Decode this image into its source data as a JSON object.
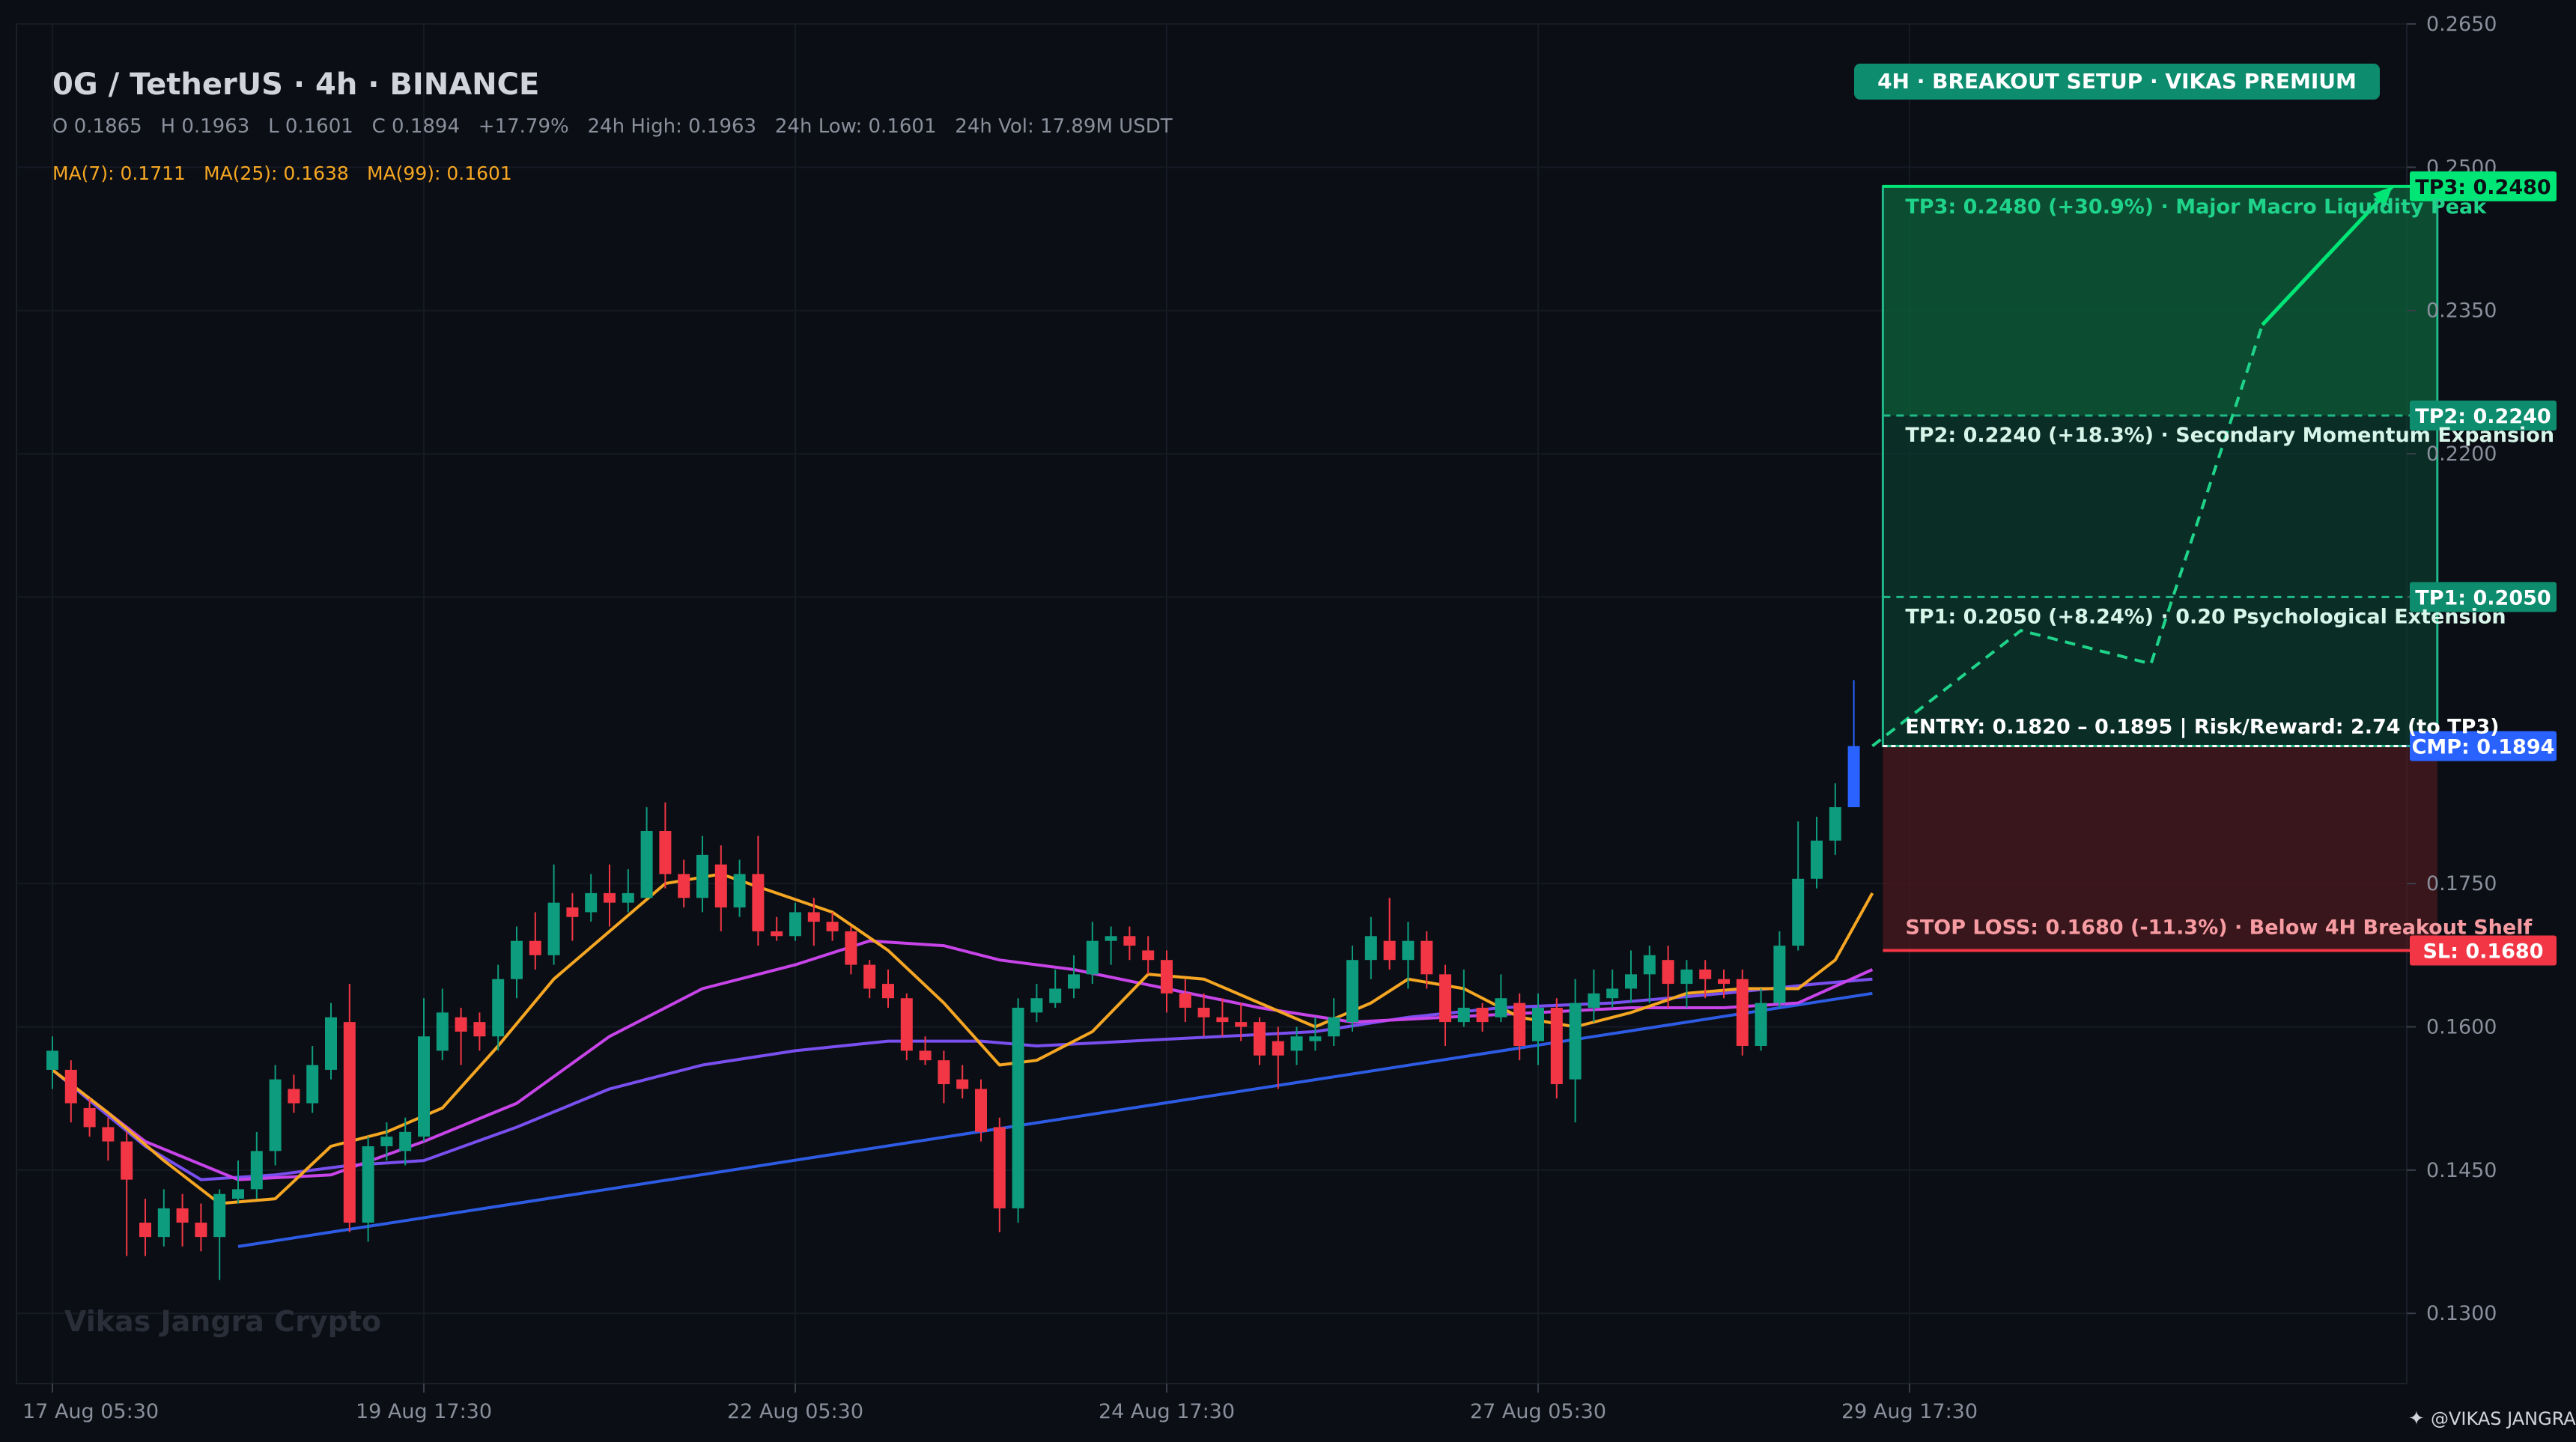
{
  "header": {
    "title": "0G / TetherUS · 4h · BINANCE",
    "ohlc_text": "O 0.1865   H 0.1963   L 0.1601   C 0.1894   +17.79%   24h High: 0.1963   24h Low: 0.1601   24h Vol: 17.89M USDT",
    "ma_labels": [
      "MA(7): 0.1711",
      "MA(25): 0.1638",
      "MA(99): 0.1601"
    ]
  },
  "badge": {
    "text": "4H · BREAKOUT SETUP · VIKAS PREMIUM"
  },
  "watermark": "Vikas Jangra Crypto",
  "credit": "@VIKAS JANGRA",
  "colors": {
    "background": "#0b0e14",
    "up": "#0e9c7e",
    "down": "#f23645",
    "ma7": "#f5a623",
    "ma25": "#c744e8",
    "ma99": "#7a4ff0",
    "trendline": "#2d5be3",
    "target_zone": "#0d5e3a",
    "stop_zone": "#4a1a1e",
    "tp3": "#00e676",
    "tp_badge": "#0e8c6e",
    "cmp": "#2962ff",
    "sl": "#f23645"
  },
  "chart_data": {
    "type": "candlestick",
    "ylim": [
      0.125,
      0.265
    ],
    "y_ticks": [
      "0.1300",
      "0.1450",
      "0.1600",
      "0.1750",
      "0.2050",
      "0.2200",
      "0.2350",
      "0.2500",
      "0.2650"
    ],
    "x_labels": [
      "17 Aug 05:30",
      "19 Aug 17:30",
      "22 Aug 05:30",
      "24 Aug 17:30",
      "27 Aug 05:30",
      "29 Aug 17:30"
    ],
    "x_label_index": [
      0,
      20,
      40,
      60,
      80,
      100
    ],
    "candles": [
      [
        0.1555,
        0.1575,
        0.159,
        0.1535
      ],
      [
        0.1555,
        0.152,
        0.1565,
        0.15
      ],
      [
        0.1515,
        0.1495,
        0.1525,
        0.1485
      ],
      [
        0.1495,
        0.148,
        0.1505,
        0.146
      ],
      [
        0.148,
        0.144,
        0.149,
        0.136
      ],
      [
        0.1395,
        0.138,
        0.142,
        0.136
      ],
      [
        0.138,
        0.141,
        0.143,
        0.137
      ],
      [
        0.141,
        0.1395,
        0.1425,
        0.137
      ],
      [
        0.1395,
        0.138,
        0.1415,
        0.1365
      ],
      [
        0.138,
        0.1425,
        0.143,
        0.1335
      ],
      [
        0.142,
        0.143,
        0.146,
        0.1415
      ],
      [
        0.143,
        0.147,
        0.149,
        0.142
      ],
      [
        0.147,
        0.1545,
        0.156,
        0.1455
      ],
      [
        0.1535,
        0.152,
        0.155,
        0.151
      ],
      [
        0.152,
        0.156,
        0.158,
        0.151
      ],
      [
        0.1555,
        0.161,
        0.1625,
        0.1545
      ],
      [
        0.1605,
        0.1395,
        0.1645,
        0.1385
      ],
      [
        0.1395,
        0.1475,
        0.1485,
        0.1375
      ],
      [
        0.1475,
        0.1485,
        0.15,
        0.146
      ],
      [
        0.147,
        0.149,
        0.1505,
        0.1455
      ],
      [
        0.1485,
        0.159,
        0.163,
        0.148
      ],
      [
        0.1575,
        0.1615,
        0.164,
        0.1565
      ],
      [
        0.161,
        0.1595,
        0.162,
        0.156
      ],
      [
        0.1605,
        0.159,
        0.1615,
        0.1575
      ],
      [
        0.159,
        0.165,
        0.1665,
        0.1575
      ],
      [
        0.165,
        0.169,
        0.1705,
        0.163
      ],
      [
        0.169,
        0.1675,
        0.172,
        0.166
      ],
      [
        0.1675,
        0.173,
        0.177,
        0.1665
      ],
      [
        0.1725,
        0.1715,
        0.174,
        0.169
      ],
      [
        0.172,
        0.174,
        0.176,
        0.171
      ],
      [
        0.174,
        0.173,
        0.177,
        0.1705
      ],
      [
        0.173,
        0.174,
        0.1765,
        0.172
      ],
      [
        0.1735,
        0.1805,
        0.183,
        0.1735
      ],
      [
        0.1805,
        0.176,
        0.1835,
        0.1745
      ],
      [
        0.176,
        0.1735,
        0.1775,
        0.1725
      ],
      [
        0.1735,
        0.178,
        0.18,
        0.172
      ],
      [
        0.177,
        0.1725,
        0.179,
        0.17
      ],
      [
        0.1725,
        0.176,
        0.1775,
        0.1715
      ],
      [
        0.176,
        0.17,
        0.18,
        0.1685
      ],
      [
        0.17,
        0.1695,
        0.1715,
        0.169
      ],
      [
        0.1695,
        0.172,
        0.173,
        0.169
      ],
      [
        0.172,
        0.171,
        0.1735,
        0.1685
      ],
      [
        0.171,
        0.17,
        0.172,
        0.169
      ],
      [
        0.17,
        0.1665,
        0.1705,
        0.1655
      ],
      [
        0.1665,
        0.164,
        0.167,
        0.163
      ],
      [
        0.1645,
        0.163,
        0.166,
        0.162
      ],
      [
        0.163,
        0.1575,
        0.1635,
        0.1565
      ],
      [
        0.1575,
        0.1565,
        0.159,
        0.156
      ],
      [
        0.1565,
        0.154,
        0.1575,
        0.152
      ],
      [
        0.1545,
        0.1535,
        0.156,
        0.1525
      ],
      [
        0.1535,
        0.149,
        0.1545,
        0.148
      ],
      [
        0.1495,
        0.141,
        0.1505,
        0.1385
      ],
      [
        0.141,
        0.162,
        0.163,
        0.1395
      ],
      [
        0.1615,
        0.163,
        0.1645,
        0.1605
      ],
      [
        0.1625,
        0.164,
        0.166,
        0.162
      ],
      [
        0.164,
        0.1655,
        0.1675,
        0.163
      ],
      [
        0.1655,
        0.169,
        0.171,
        0.1645
      ],
      [
        0.169,
        0.1695,
        0.1705,
        0.1665
      ],
      [
        0.1695,
        0.1685,
        0.1705,
        0.167
      ],
      [
        0.168,
        0.167,
        0.1695,
        0.1655
      ],
      [
        0.167,
        0.1635,
        0.168,
        0.1615
      ],
      [
        0.1635,
        0.162,
        0.165,
        0.1605
      ],
      [
        0.162,
        0.161,
        0.1635,
        0.159
      ],
      [
        0.161,
        0.1605,
        0.163,
        0.159
      ],
      [
        0.1605,
        0.16,
        0.1625,
        0.1585
      ],
      [
        0.1605,
        0.157,
        0.161,
        0.156
      ],
      [
        0.1585,
        0.157,
        0.16,
        0.1535
      ],
      [
        0.1575,
        0.159,
        0.16,
        0.156
      ],
      [
        0.1585,
        0.159,
        0.161,
        0.1575
      ],
      [
        0.159,
        0.161,
        0.163,
        0.158
      ],
      [
        0.1605,
        0.167,
        0.1685,
        0.1595
      ],
      [
        0.167,
        0.1695,
        0.1715,
        0.165
      ],
      [
        0.169,
        0.167,
        0.1735,
        0.166
      ],
      [
        0.167,
        0.169,
        0.171,
        0.164
      ],
      [
        0.169,
        0.1655,
        0.17,
        0.164
      ],
      [
        0.1655,
        0.1605,
        0.1665,
        0.158
      ],
      [
        0.1605,
        0.162,
        0.166,
        0.16
      ],
      [
        0.162,
        0.1605,
        0.1625,
        0.1595
      ],
      [
        0.161,
        0.163,
        0.1655,
        0.1605
      ],
      [
        0.1625,
        0.158,
        0.1635,
        0.1565
      ],
      [
        0.1585,
        0.162,
        0.1635,
        0.156
      ],
      [
        0.162,
        0.154,
        0.163,
        0.1525
      ],
      [
        0.1545,
        0.1625,
        0.165,
        0.15
      ],
      [
        0.162,
        0.1635,
        0.166,
        0.1605
      ],
      [
        0.163,
        0.164,
        0.166,
        0.162
      ],
      [
        0.164,
        0.1655,
        0.168,
        0.1625
      ],
      [
        0.1655,
        0.1675,
        0.1685,
        0.1625
      ],
      [
        0.167,
        0.1645,
        0.1685,
        0.162
      ],
      [
        0.1645,
        0.166,
        0.167,
        0.162
      ],
      [
        0.166,
        0.165,
        0.167,
        0.163
      ],
      [
        0.165,
        0.1645,
        0.166,
        0.163
      ],
      [
        0.165,
        0.158,
        0.166,
        0.157
      ],
      [
        0.158,
        0.1625,
        0.164,
        0.1575
      ],
      [
        0.1625,
        0.1685,
        0.17,
        0.162
      ],
      [
        0.1685,
        0.1755,
        0.1815,
        0.168
      ],
      [
        0.1755,
        0.1795,
        0.182,
        0.1745
      ],
      [
        0.1795,
        0.183,
        0.1855,
        0.178
      ],
      [
        0.183,
        0.1894,
        0.1963,
        0.183
      ]
    ],
    "indicators": {
      "ma7": [
        [
          0,
          0.1555
        ],
        [
          3,
          0.151
        ],
        [
          6,
          0.146
        ],
        [
          9,
          0.1415
        ],
        [
          12,
          0.142
        ],
        [
          15,
          0.1475
        ],
        [
          18,
          0.149
        ],
        [
          21,
          0.1515
        ],
        [
          24,
          0.158
        ],
        [
          27,
          0.165
        ],
        [
          30,
          0.17
        ],
        [
          33,
          0.175
        ],
        [
          36,
          0.176
        ],
        [
          39,
          0.174
        ],
        [
          42,
          0.172
        ],
        [
          45,
          0.168
        ],
        [
          48,
          0.1625
        ],
        [
          51,
          0.156
        ],
        [
          53,
          0.1565
        ],
        [
          56,
          0.1595
        ],
        [
          59,
          0.1655
        ],
        [
          62,
          0.165
        ],
        [
          65,
          0.1625
        ],
        [
          68,
          0.16
        ],
        [
          71,
          0.1625
        ],
        [
          73,
          0.165
        ],
        [
          76,
          0.164
        ],
        [
          79,
          0.161
        ],
        [
          82,
          0.16
        ],
        [
          85,
          0.1615
        ],
        [
          88,
          0.1635
        ],
        [
          91,
          0.164
        ],
        [
          94,
          0.164
        ],
        [
          96,
          0.167
        ],
        [
          98,
          0.174
        ]
      ],
      "ma25": [
        [
          0,
          0.1555
        ],
        [
          5,
          0.148
        ],
        [
          10,
          0.144
        ],
        [
          15,
          0.1445
        ],
        [
          20,
          0.148
        ],
        [
          25,
          0.152
        ],
        [
          30,
          0.159
        ],
        [
          35,
          0.164
        ],
        [
          40,
          0.1665
        ],
        [
          44,
          0.169
        ],
        [
          48,
          0.1685
        ],
        [
          51,
          0.167
        ],
        [
          55,
          0.166
        ],
        [
          60,
          0.164
        ],
        [
          65,
          0.162
        ],
        [
          70,
          0.1605
        ],
        [
          75,
          0.161
        ],
        [
          80,
          0.1615
        ],
        [
          85,
          0.162
        ],
        [
          90,
          0.162
        ],
        [
          94,
          0.1625
        ],
        [
          98,
          0.166
        ]
      ],
      "ma99": [
        [
          0,
          0.1555
        ],
        [
          5,
          0.1475
        ],
        [
          8,
          0.144
        ],
        [
          12,
          0.1445
        ],
        [
          16,
          0.1455
        ],
        [
          20,
          0.146
        ],
        [
          25,
          0.1495
        ],
        [
          30,
          0.1535
        ],
        [
          35,
          0.156
        ],
        [
          40,
          0.1575
        ],
        [
          45,
          0.1585
        ],
        [
          50,
          0.1585
        ],
        [
          53,
          0.158
        ],
        [
          58,
          0.1585
        ],
        [
          63,
          0.159
        ],
        [
          68,
          0.1595
        ],
        [
          73,
          0.161
        ],
        [
          78,
          0.162
        ],
        [
          84,
          0.1625
        ],
        [
          90,
          0.1635
        ],
        [
          95,
          0.1645
        ],
        [
          98,
          0.165
        ]
      ],
      "trendline": [
        [
          10,
          0.137
        ],
        [
          98,
          0.1635
        ]
      ]
    },
    "levels": {
      "entry": [
        0.182,
        0.1895
      ],
      "cmp": 0.1894,
      "tp1": 0.205,
      "tp2": 0.224,
      "tp3": 0.248,
      "sl": 0.168,
      "risk_reward_to_tp3": 2.74
    },
    "projection_path": [
      [
        98,
        0.1894
      ],
      [
        106,
        0.2015
      ],
      [
        113,
        0.198
      ],
      [
        119,
        0.2335
      ],
      [
        126,
        0.248
      ]
    ],
    "projection_path_2": [
      [
        119,
        0.2335
      ],
      [
        126,
        0.248
      ]
    ],
    "price_tags": {
      "tp3": "TP3: 0.2480",
      "tp2": "TP2: 0.2240",
      "tp1": "TP1: 0.2050",
      "cmp": "CMP: 0.1894",
      "sl": "SL: 0.1680"
    },
    "zone_labels": {
      "tp3": "TP3: 0.2480 (+30.9%) · Major Macro Liquidity Peak",
      "tp2": "TP2: 0.2240 (+18.3%) · Secondary Momentum Expansion",
      "tp1": "TP1: 0.2050 (+8.24%) · 0.20 Psychological Extension",
      "entry": "ENTRY: 0.1820 – 0.1895  |  Risk/Reward: 2.74 (to TP3)",
      "sl": "STOP LOSS: 0.1680 (-11.3%) · Below 4H Breakout Shelf"
    }
  }
}
